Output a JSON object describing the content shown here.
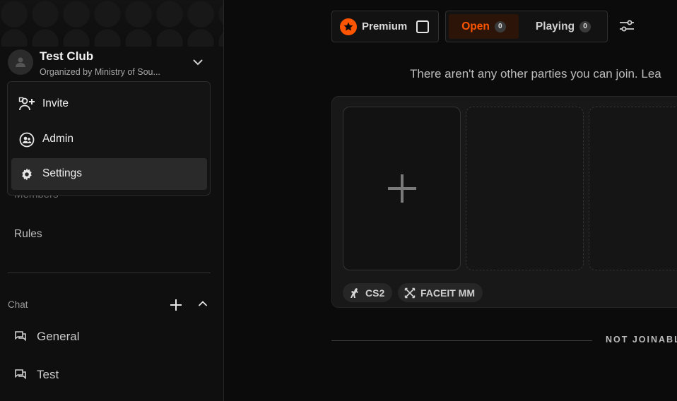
{
  "sidebar": {
    "club": {
      "name": "Test Club",
      "organizer": "Organized by Ministry of Sou..."
    },
    "menu": [
      {
        "label": "Invite",
        "icon": "invite-user-icon"
      },
      {
        "label": "Admin",
        "icon": "admin-icon"
      },
      {
        "label": "Settings",
        "icon": "gear-icon",
        "active": true
      }
    ],
    "hidden_item": "Members",
    "rules_label": "Rules",
    "chat": {
      "heading": "Chat",
      "channels": [
        {
          "label": "General",
          "icon": "chat-bubbles-icon"
        },
        {
          "label": "Test",
          "icon": "chat-bubbles-icon"
        }
      ]
    }
  },
  "toolbar": {
    "premium_label": "Premium",
    "premium_checked": false,
    "tabs": [
      {
        "label": "Open",
        "count": "0",
        "active": true
      },
      {
        "label": "Playing",
        "count": "0",
        "active": false
      }
    ]
  },
  "main": {
    "info_text": "There aren't any other parties you can join. Lea",
    "tags": [
      {
        "label": "CS2",
        "icon": "cs2-icon"
      },
      {
        "label": "FACEIT MM",
        "icon": "faceit-mm-icon"
      }
    ],
    "not_joinable_label": "NOT JOINABL"
  },
  "colors": {
    "accent": "#ff5500",
    "background": "#0b0b0b",
    "panel": "#181818",
    "active_tab_bg": "#2d1408"
  }
}
